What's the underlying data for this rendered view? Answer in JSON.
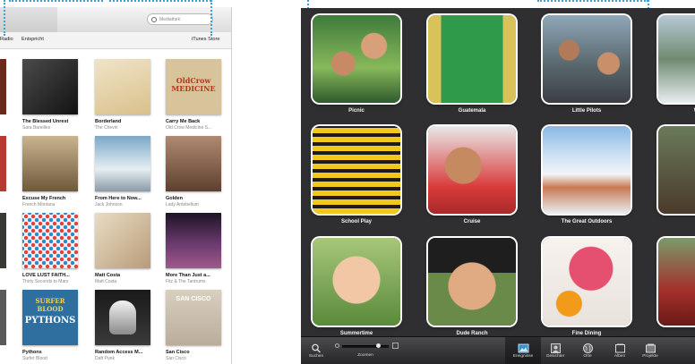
{
  "itunes": {
    "search_placeholder": "Mediathek",
    "nav": {
      "left1": "Radio",
      "left2": "Entspricht",
      "right": "iTunes Store"
    },
    "albums": [
      {
        "title": "The Blessed Unrest",
        "artist": "Sara Bareilles"
      },
      {
        "title": "Borderland",
        "artist": "The Chevin"
      },
      {
        "title": "Carry Me Back",
        "artist": "Old Crow Medicine S..."
      },
      {
        "title": "Excuse My French",
        "artist": "French Montana"
      },
      {
        "title": "From Here to Now...",
        "artist": "Jack Johnson"
      },
      {
        "title": "Golden",
        "artist": "Lady Antebellum"
      },
      {
        "title": "LOVE LUST FAITH...",
        "artist": "Thirty Seconds to Mars"
      },
      {
        "title": "Matt Costa",
        "artist": "Matt Costa"
      },
      {
        "title": "More Than Just a...",
        "artist": "Fitz & The Tantrums"
      },
      {
        "title": "Pythons",
        "artist": "Surfer Blood"
      },
      {
        "title": "Random Access M...",
        "artist": "Daft Punk"
      },
      {
        "title": "San Cisco",
        "artist": "San Cisco"
      }
    ],
    "cover_text": {
      "oldcrow": "OldCrow MEDICINE",
      "surfer_top": "SURFER BLOOD",
      "surfer_bottom": "PYTHONS",
      "sancisco": "SAN CISCO"
    }
  },
  "iphoto": {
    "events": [
      {
        "label": "Picnic"
      },
      {
        "label": "Guatemala"
      },
      {
        "label": "Little Pilots"
      },
      {
        "label": "Winter"
      },
      {
        "label": "School Play"
      },
      {
        "label": "Cruise"
      },
      {
        "label": "The Great Outdoors"
      },
      {
        "label": "Ad"
      },
      {
        "label": "Summertime"
      },
      {
        "label": "Dude Ranch"
      },
      {
        "label": "Fine Dining"
      },
      {
        "label": "Scoo"
      }
    ],
    "toolbar": {
      "search": "Suchen",
      "zoom": "Zoomen",
      "events": "Ereignisse",
      "faces": "Gesichter",
      "places": "Orte",
      "albums": "Alben",
      "projects": "Projekte"
    }
  }
}
